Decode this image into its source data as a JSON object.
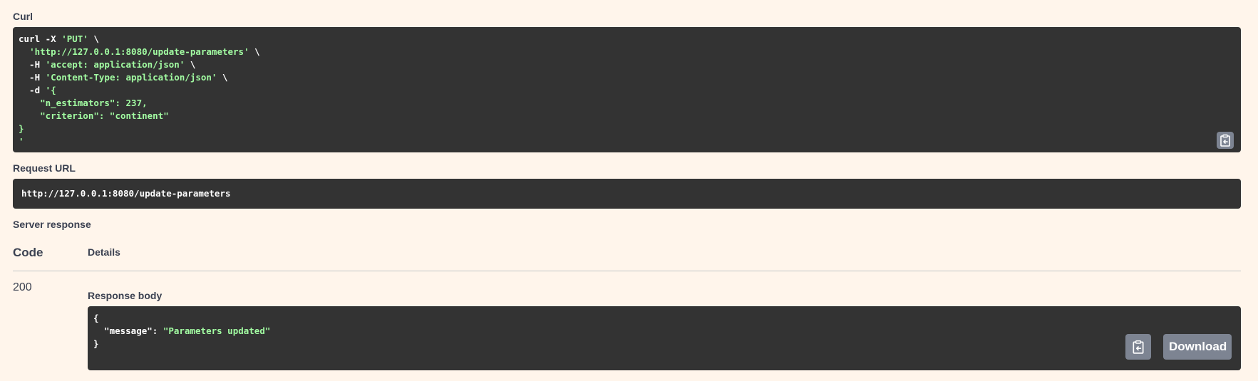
{
  "curl": {
    "label": "Curl",
    "lines": [
      [
        {
          "t": "curl -X ",
          "c": "plain"
        },
        {
          "t": "'PUT'",
          "c": "str"
        },
        {
          "t": " \\",
          "c": "plain"
        }
      ],
      [
        {
          "t": "  ",
          "c": "plain"
        },
        {
          "t": "'http://127.0.0.1:8080/update-parameters'",
          "c": "str"
        },
        {
          "t": " \\",
          "c": "plain"
        }
      ],
      [
        {
          "t": "  -H ",
          "c": "plain"
        },
        {
          "t": "'accept: application/json'",
          "c": "str"
        },
        {
          "t": " \\",
          "c": "plain"
        }
      ],
      [
        {
          "t": "  -H ",
          "c": "plain"
        },
        {
          "t": "'Content-Type: application/json'",
          "c": "str"
        },
        {
          "t": " \\",
          "c": "plain"
        }
      ],
      [
        {
          "t": "  -d ",
          "c": "plain"
        },
        {
          "t": "'{",
          "c": "str"
        }
      ],
      [
        {
          "t": "    \"n_estimators\": 237,",
          "c": "str"
        }
      ],
      [
        {
          "t": "    \"criterion\": \"continent\"",
          "c": "str"
        }
      ],
      [
        {
          "t": "}",
          "c": "str"
        }
      ],
      [
        {
          "t": "'",
          "c": "str"
        }
      ]
    ],
    "copy_icon": "clipboard-icon"
  },
  "request_url": {
    "label": "Request URL",
    "value": "http://127.0.0.1:8080/update-parameters"
  },
  "server_response": {
    "label": "Server response",
    "code_header": "Code",
    "details_header": "Details",
    "code": "200",
    "response_body_label": "Response body",
    "body_lines": [
      [
        {
          "t": "{",
          "c": "plain"
        }
      ],
      [
        {
          "t": "  \"message\"",
          "c": "plain"
        },
        {
          "t": ": ",
          "c": "plain"
        },
        {
          "t": "\"Parameters updated\"",
          "c": "str"
        }
      ],
      [
        {
          "t": "}",
          "c": "plain"
        }
      ]
    ],
    "copy_icon": "clipboard-icon",
    "download_label": "Download"
  },
  "colors": {
    "background": "#fff5eb",
    "code_background": "#333333",
    "string": "#a2fca2",
    "button": "#7d8492"
  }
}
